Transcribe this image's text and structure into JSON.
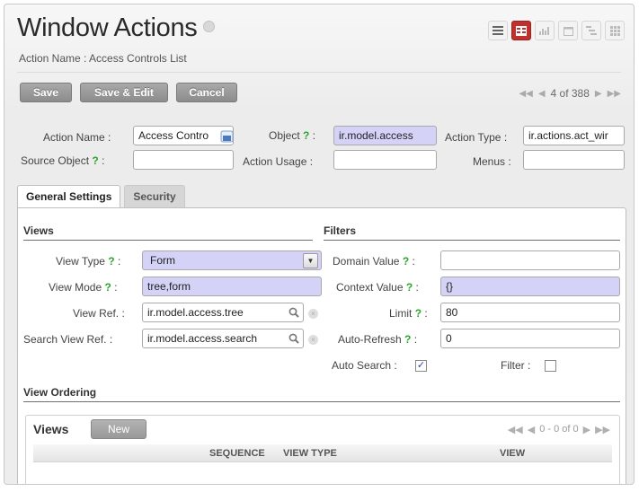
{
  "header": {
    "title": "Window Actions",
    "breadcrumb": "Action Name : Access Controls List"
  },
  "view_switcher": {
    "items": [
      {
        "icon": "list-icon",
        "active": false
      },
      {
        "icon": "form-icon",
        "active": true
      },
      {
        "icon": "graph-icon",
        "active": false
      },
      {
        "icon": "calendar-icon",
        "active": false
      },
      {
        "icon": "gantt-icon",
        "active": false
      },
      {
        "icon": "kanban-icon",
        "active": false
      }
    ]
  },
  "toolbar": {
    "save_label": "Save",
    "save_edit_label": "Save & Edit",
    "cancel_label": "Cancel",
    "pager_text": "4 of 388"
  },
  "form": {
    "action_name": {
      "label": "Action Name :",
      "value": "Access Contro"
    },
    "object": {
      "label": "Object",
      "help": "?",
      "sep": ":",
      "value": "ir.model.access"
    },
    "action_type": {
      "label": "Action Type :",
      "value": "ir.actions.act_wir"
    },
    "source_object": {
      "label": "Source Object",
      "help": "?",
      "sep": ":",
      "value": ""
    },
    "action_usage": {
      "label": "Action Usage :",
      "value": ""
    },
    "menus": {
      "label": "Menus :",
      "value": ""
    }
  },
  "tabs": [
    {
      "label": "General Settings",
      "active": true
    },
    {
      "label": "Security",
      "active": false
    }
  ],
  "views_section": {
    "title": "Views",
    "view_type": {
      "label": "View Type",
      "help": "?",
      "sep": ":",
      "value": "Form"
    },
    "view_mode": {
      "label": "View Mode",
      "help": "?",
      "sep": ":",
      "value": "tree,form"
    },
    "view_ref": {
      "label": "View Ref. :",
      "value": "ir.model.access.tree"
    },
    "search_view_ref": {
      "label": "Search View Ref. :",
      "value": "ir.model.access.search"
    }
  },
  "filters_section": {
    "title": "Filters",
    "domain_value": {
      "label": "Domain Value",
      "help": "?",
      "sep": ":",
      "value": ""
    },
    "context_value": {
      "label": "Context Value",
      "help": "?",
      "sep": ":",
      "value": "{}"
    },
    "limit": {
      "label": "Limit",
      "help": "?",
      "sep": ":",
      "value": "80"
    },
    "auto_refresh": {
      "label": "Auto-Refresh",
      "help": "?",
      "sep": ":",
      "value": "0"
    },
    "auto_search": {
      "label": "Auto Search :",
      "checked": true
    },
    "filter": {
      "label": "Filter :",
      "checked": false
    }
  },
  "view_ordering": {
    "title": "View Ordering",
    "list_title": "Views",
    "new_label": "New",
    "pager_text": "0 - 0 of 0",
    "columns": [
      "SEQUENCE",
      "VIEW TYPE",
      "VIEW"
    ]
  },
  "colors": {
    "accent_red": "#c0302d",
    "required_bg": "#d4d2f7",
    "help_green": "#2da52a"
  }
}
